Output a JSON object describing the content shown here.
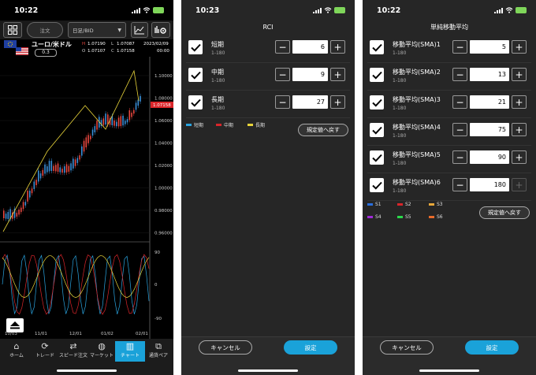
{
  "chart_screen": {
    "time": "10:22",
    "toolbar": {
      "order_label": "注文",
      "price_type": "日足/BID"
    },
    "pair": {
      "name": "ユーロ/米ドル",
      "spread": "0.3",
      "high_label": "H",
      "high": "1.07190",
      "low_label": "L",
      "low": "1.07087",
      "open_label": "O",
      "open": "1.07107",
      "close_label": "C",
      "close": "1.07158",
      "date": "2023/02/09",
      "clock": "00:00"
    },
    "price_axis": [
      "1.10000",
      "1.08000",
      "1.06000",
      "1.04000",
      "1.02000",
      "1.00000",
      "0.98000",
      "0.96000"
    ],
    "current_price": "1.07158",
    "rci_axis": [
      "90",
      "0",
      "-90"
    ],
    "date_axis": [
      "10/03",
      "11/01",
      "12/01",
      "01/02",
      "02/01"
    ],
    "tabs": [
      {
        "label": "ホーム",
        "icon": "home-icon"
      },
      {
        "label": "トレード",
        "icon": "trade-icon"
      },
      {
        "label": "スピード注文",
        "icon": "speed-order-icon"
      },
      {
        "label": "マーケット",
        "icon": "globe-icon"
      },
      {
        "label": "チャート",
        "icon": "chart-icon"
      },
      {
        "label": "通貨ペア",
        "icon": "currency-pair-icon"
      }
    ],
    "colors": {
      "up": "#e8473f",
      "down": "#3a8fd9",
      "trend": "#e8d43a",
      "accent": "#1aa2d9"
    }
  },
  "rci_screen": {
    "time": "10:23",
    "title": "RCI",
    "rows": [
      {
        "name": "短期",
        "range": "1-180",
        "value": "6",
        "checked": true
      },
      {
        "name": "中期",
        "range": "1-180",
        "value": "9",
        "checked": true
      },
      {
        "name": "長期",
        "range": "1-180",
        "value": "27",
        "checked": true
      }
    ],
    "legend": [
      {
        "name": "短期",
        "color": "#2aa4e0"
      },
      {
        "name": "中期",
        "color": "#d9252a"
      },
      {
        "name": "長期",
        "color": "#e8d43a"
      }
    ],
    "reset_label": "規定値へ戻す",
    "cancel_label": "キャンセル",
    "ok_label": "設定"
  },
  "sma_screen": {
    "time": "10:22",
    "title": "単純移動平均",
    "rows": [
      {
        "name": "移動平均(SMA)1",
        "range": "1-180",
        "value": "5",
        "checked": true
      },
      {
        "name": "移動平均(SMA)2",
        "range": "1-180",
        "value": "13",
        "checked": true
      },
      {
        "name": "移動平均(SMA)3",
        "range": "1-180",
        "value": "21",
        "checked": true
      },
      {
        "name": "移動平均(SMA)4",
        "range": "1-180",
        "value": "75",
        "checked": true
      },
      {
        "name": "移動平均(SMA)5",
        "range": "1-180",
        "value": "90",
        "checked": true
      },
      {
        "name": "移動平均(SMA)6",
        "range": "1-180",
        "value": "180",
        "checked": true
      }
    ],
    "legend": [
      {
        "name": "S1",
        "color": "#2a6fe0"
      },
      {
        "name": "S2",
        "color": "#d9252a"
      },
      {
        "name": "S3",
        "color": "#e8a83a"
      },
      {
        "name": "S4",
        "color": "#a02ad9"
      },
      {
        "name": "S5",
        "color": "#2ad94a"
      },
      {
        "name": "S6",
        "color": "#e86a2a"
      }
    ],
    "reset_label": "規定値へ戻す",
    "cancel_label": "キャンセル",
    "ok_label": "設定"
  }
}
